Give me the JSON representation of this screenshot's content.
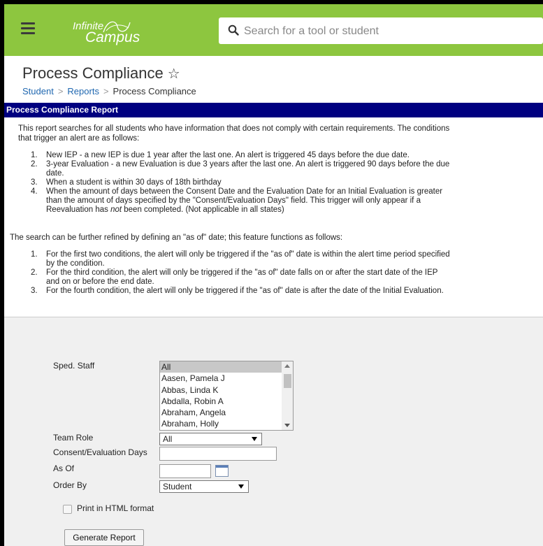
{
  "app": {
    "logo_line1": "Infinite",
    "logo_line2": "Campus"
  },
  "search": {
    "placeholder": "Search for a tool or student"
  },
  "page": {
    "title": "Process Compliance",
    "star": "☆"
  },
  "breadcrumb": {
    "items": [
      "Student",
      "Reports",
      "Process Compliance"
    ],
    "separator": ">"
  },
  "report": {
    "header": "Process Compliance Report",
    "intro_line1": "This report searches for all students who have information that does not comply with certain requirements. The conditions",
    "intro_line2": "that trigger an alert are as follows:",
    "conditions": [
      {
        "n": "1.",
        "lines": [
          "New IEP - a new IEP is due 1 year after the last one. An alert is triggered 45 days before the due date."
        ]
      },
      {
        "n": "2.",
        "lines": [
          "3-year Evaluation - a new Evaluation is due 3 years after the last one. An alert is triggered 90 days before the due",
          "date."
        ]
      },
      {
        "n": "3.",
        "lines": [
          "When a student is within 30 days of 18th birthday"
        ]
      },
      {
        "n": "4.",
        "lines": [
          "When the amount of days between the Consent Date and the Evaluation Date for an Initial Evaluation is greater",
          "than the amount of days specified by the \"Consent/Evaluation Days\" field. This trigger will only appear if a"
        ],
        "line3_pre": "Reevaluation has ",
        "line3_em": "not",
        "line3_post": " been completed. (Not applicable in all states)"
      }
    ],
    "refine_intro": "The search can be further refined by defining an \"as of\" date; this feature functions as follows:",
    "refinements": [
      {
        "n": "1.",
        "lines": [
          "For the first two conditions, the alert will only be triggered if the \"as of\" date is within the alert time period specified",
          "by the condition."
        ]
      },
      {
        "n": "2.",
        "lines": [
          "For the third condition, the alert will only be triggered if the \"as of\" date falls on or after the start date of the IEP",
          "and on or before the end date."
        ]
      },
      {
        "n": "3.",
        "lines": [
          "For the fourth condition, the alert will only be triggered if the \"as of\" date is after the date of the Initial Evaluation."
        ]
      }
    ]
  },
  "form": {
    "sped_staff_label": "Sped. Staff",
    "sped_staff_options": [
      "All",
      "Aasen, Pamela J",
      "Abbas, Linda K",
      "Abdalla, Robin A",
      "Abraham, Angela",
      "Abraham, Holly"
    ],
    "sped_staff_selected": "All",
    "team_role_label": "Team Role",
    "team_role_value": "All",
    "consent_days_label": "Consent/Evaluation Days",
    "consent_days_value": "",
    "as_of_label": "As Of",
    "as_of_value": "",
    "order_by_label": "Order By",
    "order_by_value": "Student",
    "print_html_label": "Print in HTML format",
    "print_html_checked": false,
    "generate_label": "Generate Report"
  },
  "colors": {
    "topbar": "#8dc63f",
    "report_header": "#000080",
    "link": "#1f67b0"
  }
}
